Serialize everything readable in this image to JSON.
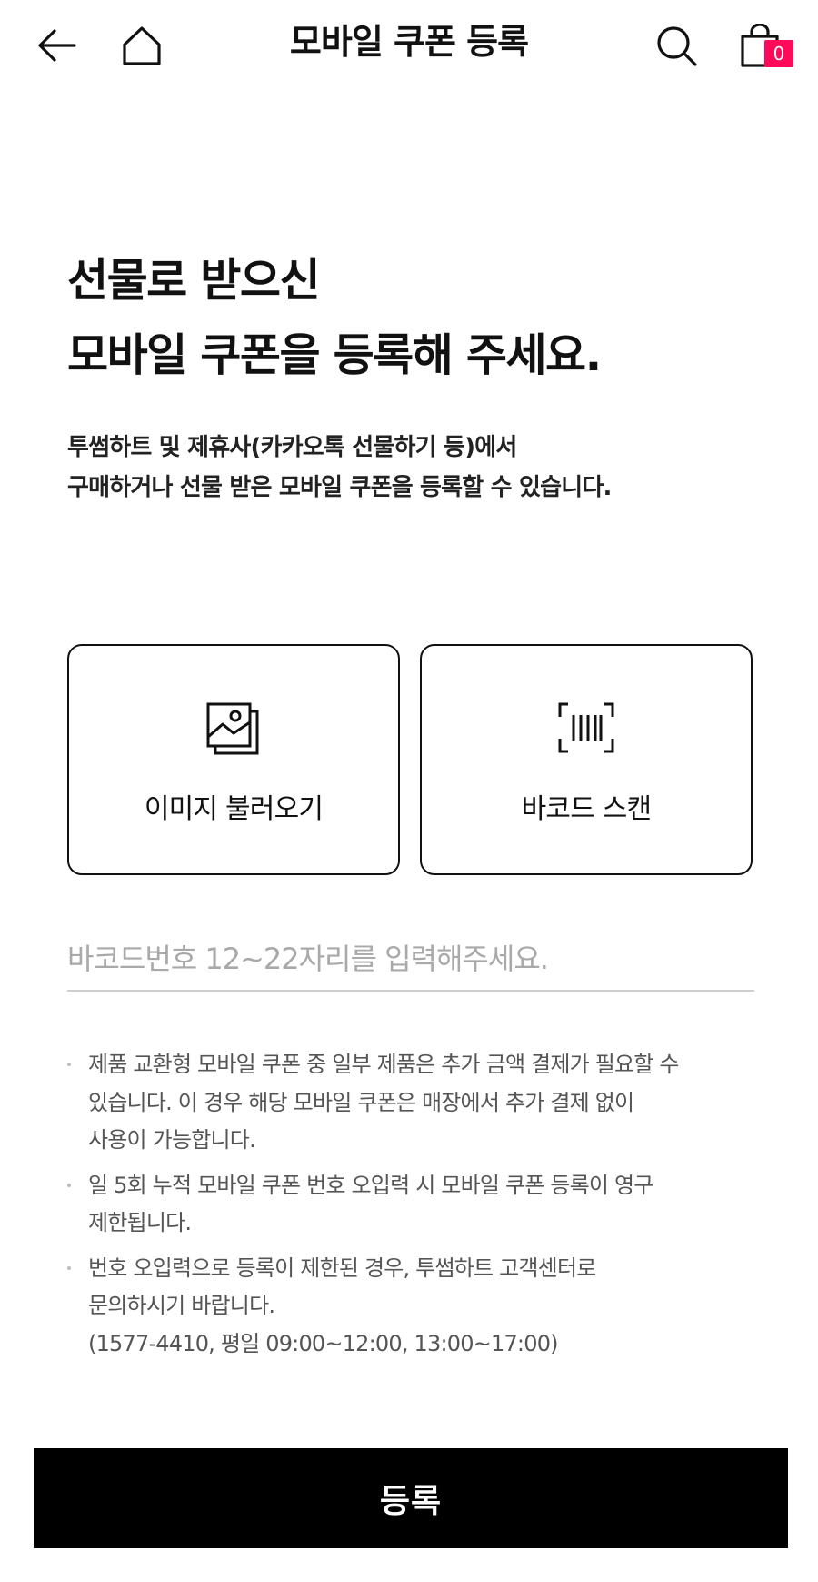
{
  "header": {
    "title": "모바일 쿠폰 등록",
    "cart_count": "0",
    "icons": {
      "back": "arrow-left-icon",
      "home": "home-icon",
      "search": "search-icon",
      "cart": "shopping-bag-icon"
    },
    "badge_color": "#ff0a5a"
  },
  "headline": {
    "line1": "선물로 받으신",
    "line2": "모바일 쿠폰을 등록해 주세요."
  },
  "description": {
    "line1": "투썸하트 및 제휴사(카카오톡 선물하기 등)에서",
    "line2": "구매하거나 선물 받은 모바일 쿠폰을 등록할 수 있습니다."
  },
  "options": [
    {
      "label": "이미지 불러오기",
      "icon": "image-gallery-icon"
    },
    {
      "label": "바코드 스캔",
      "icon": "barcode-scan-icon"
    }
  ],
  "barcode_input": {
    "value": "",
    "placeholder": "바코드번호 12~22자리를 입력해주세요."
  },
  "notices": [
    {
      "lines": [
        "제품 교환형 모바일 쿠폰 중 일부 제품은 추가 금액 결제가 필요할 수",
        "있습니다. 이 경우 해당 모바일 쿠폰은 매장에서 추가 결제 없이",
        "사용이 가능합니다."
      ]
    },
    {
      "lines": [
        "일 5회 누적 모바일 쿠폰 번호 오입력 시 모바일 쿠폰 등록이 영구",
        "제한됩니다."
      ]
    },
    {
      "lines": [
        "번호 오입력으로 등록이 제한된 경우, 투썸하트 고객센터로",
        "문의하시기 바랍니다.",
        "(1577-4410, 평일 09:00~12:00, 13:00~17:00)"
      ]
    }
  ],
  "submit": {
    "label": "등록"
  },
  "colors": {
    "primary": "#000000",
    "accent": "#ff0a5a",
    "muted_text": "#555555",
    "placeholder": "#a9a9a9"
  }
}
